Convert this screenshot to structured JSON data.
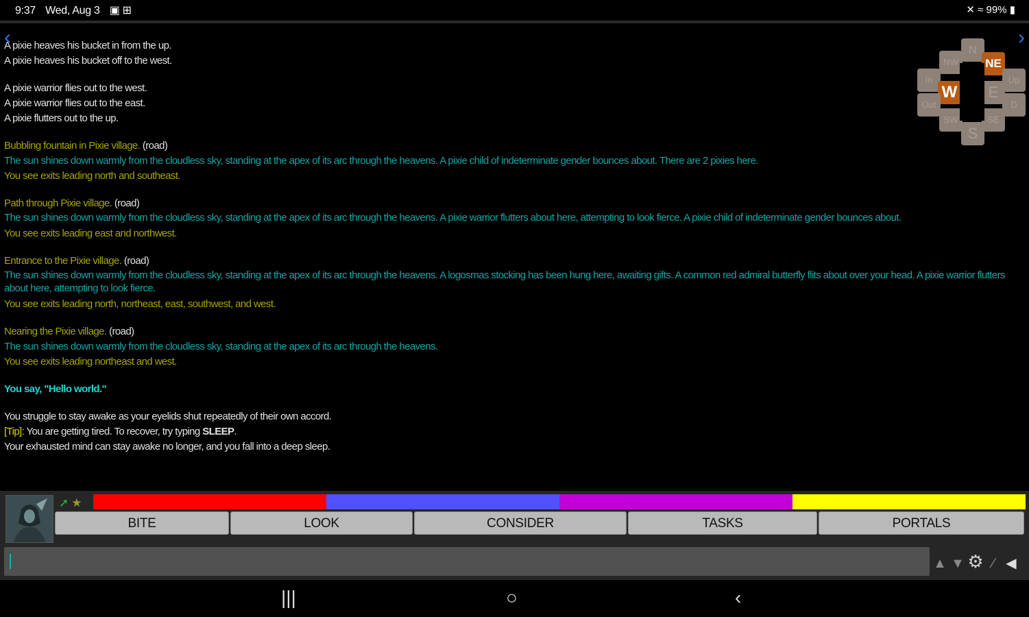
{
  "status_bar": {
    "time": "9:37",
    "date": "Wed, Aug 3",
    "battery": "99%"
  },
  "nav": {
    "left_arrow": "‹",
    "right_arrow": "›"
  },
  "output": {
    "l1": "A pixie heaves his bucket in from the up.",
    "l2": "A pixie heaves his bucket off to the west.",
    "l3": "A pixie warrior flies out to the west.",
    "l4": "A pixie warrior flies out to the east.",
    "l5": "A pixie flutters out to the up.",
    "r1_title": "Bubbling fountain in Pixie village.",
    "r1_tag": "(road)",
    "r1_desc": "The sun shines down warmly from the cloudless sky, standing at the apex of its arc through the heavens. A pixie child of indeterminate gender bounces about. There are 2 pixies here.",
    "r1_exits": "You see exits leading north and southeast.",
    "r2_title": "Path through Pixie village.",
    "r2_tag": "(road)",
    "r2_desc": "The sun shines down warmly from the cloudless sky, standing at the apex of its arc through the heavens. A pixie warrior flutters about here, attempting to look fierce. A pixie child of indeterminate gender bounces about.",
    "r2_exits": "You see exits leading east and northwest.",
    "r3_title": "Entrance to the Pixie village.",
    "r3_tag": "(road)",
    "r3_desc": "The sun shines down warmly from the cloudless sky, standing at the apex of its arc through the heavens. A logosmas stocking has been hung here, awaiting gifts. A common red admiral butterfly flits about over your head. A pixie warrior flutters about here, attempting to look fierce.",
    "r3_exits": "You see exits leading north, northeast, east, southwest, and west.",
    "r4_title": "Nearing the Pixie village.",
    "r4_tag": "(road)",
    "r4_desc": "The sun shines down warmly from the cloudless sky, standing at the apex of its arc through the heavens.",
    "r4_exits": "You see exits leading northeast and west.",
    "say": "You say, \"Hello world.\"",
    "struggle": "You struggle to stay awake as your eyelids shut repeatedly of their own accord.",
    "tip_label": "[Tip]:",
    "tip_text": "You are getting tired. To recover, try typing",
    "tip_cmd": "SLEEP",
    "tip_end": ".",
    "sleep": "Your exhausted mind can stay awake no longer, and you fall into a deep sleep."
  },
  "compass": {
    "n": "N",
    "ne": "NE",
    "nw": "NW",
    "in": "In",
    "up": "Up",
    "w": "W",
    "e": "E",
    "out": "Out",
    "d": "D",
    "sw": "SW",
    "se": "SE",
    "s": "S"
  },
  "colors": {
    "bar1": "#ff0000",
    "bar2": "#5050ff",
    "bar3": "#c400d8",
    "bar4": "#ffff00",
    "compass_active": "#b85a14"
  },
  "buttons": {
    "b1": "BITE",
    "b2": "LOOK",
    "b3": "CONSIDER",
    "b4": "TASKS",
    "b5": "PORTALS"
  },
  "icons": {
    "pin": "pin-icon",
    "star": "star-icon",
    "gear": "gear-icon",
    "speaker": "speaker-icon",
    "up": "arrow-up-icon",
    "down": "arrow-down-icon"
  },
  "navbar": {
    "recents": "|||",
    "home": "○",
    "back": "‹"
  },
  "input": {
    "value": ""
  }
}
